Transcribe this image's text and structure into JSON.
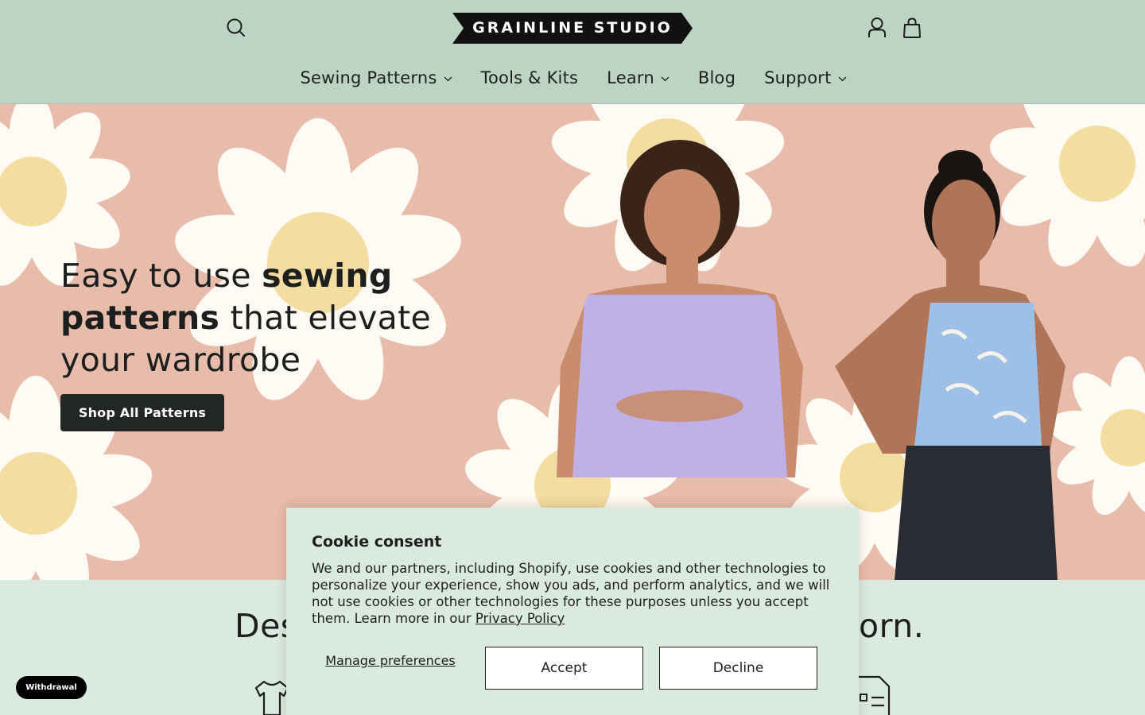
{
  "header": {
    "logo_text": "GRAINLINE STUDIO",
    "search_icon": "search-icon",
    "account_icon": "user-icon",
    "cart_icon": "shopping-bag-icon"
  },
  "nav": {
    "items": [
      {
        "label": "Sewing Patterns",
        "has_dropdown": true
      },
      {
        "label": "Tools & Kits",
        "has_dropdown": false
      },
      {
        "label": "Learn",
        "has_dropdown": true
      },
      {
        "label": "Blog",
        "has_dropdown": false
      },
      {
        "label": "Support",
        "has_dropdown": true
      }
    ]
  },
  "hero": {
    "heading_part1": "Easy to use ",
    "heading_bold": "sewing patterns",
    "heading_part2": " that elevate your wardrobe",
    "button_label": "Shop All Patterns"
  },
  "section2": {
    "heading_left": "Des",
    "heading_right": "orn."
  },
  "cookie": {
    "title": "Cookie consent",
    "text": "We and our partners, including Shopify, use cookies and other technologies to personalize your experience, show you ads, and perform analytics, and we will not use cookies or other technologies for these purposes unless you accept them. Learn more in our ",
    "privacy_link": "Privacy Policy",
    "manage_label": "Manage preferences",
    "accept_label": "Accept",
    "decline_label": "Decline"
  },
  "withdrawal_label": "Withdrawal",
  "colors": {
    "header_bg": "#bdd4c5",
    "hero_bg": "#e8bcaa",
    "section_bg": "#dbeadf",
    "dark": "#1d1f1e"
  }
}
